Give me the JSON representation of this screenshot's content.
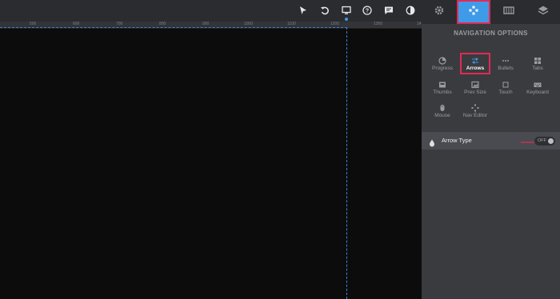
{
  "toolbar": {
    "icons": [
      "cursor-icon",
      "undo-icon",
      "monitor-icon",
      "help-icon",
      "comment-icon",
      "contrast-icon"
    ]
  },
  "ruler": {
    "ticks": [
      "500",
      "600",
      "700",
      "800",
      "900",
      "1000",
      "1100",
      "1200",
      "1300",
      "14"
    ]
  },
  "panel": {
    "tabs": [
      "gear-icon",
      "navigation-icon",
      "media-icon",
      "layers-icon"
    ],
    "title": "NAVIGATION OPTIONS",
    "options": [
      {
        "label": "Progress",
        "icon": "progress-icon"
      },
      {
        "label": "Arrows",
        "icon": "arrows-icon"
      },
      {
        "label": "Bullets",
        "icon": "bullets-icon"
      },
      {
        "label": "Tabs",
        "icon": "tabs-icon"
      },
      {
        "label": "Thumbs",
        "icon": "thumbs-icon"
      },
      {
        "label": "Prev Size",
        "icon": "prev-size-icon"
      },
      {
        "label": "Touch",
        "icon": "touch-icon"
      },
      {
        "label": "Keyboard",
        "icon": "keyboard-icon"
      },
      {
        "label": "Mouse",
        "icon": "mouse-icon"
      },
      {
        "label": "Nav Editor",
        "icon": "nav-editor-icon"
      }
    ],
    "arrow_type": {
      "label": "Arrow Type",
      "toggle": "OFF"
    }
  },
  "colors": {
    "accent": "#3f9ae8",
    "highlight": "#e22a55",
    "panel_bg": "#3a3b3f",
    "canvas_bg": "#0c0c0c"
  }
}
